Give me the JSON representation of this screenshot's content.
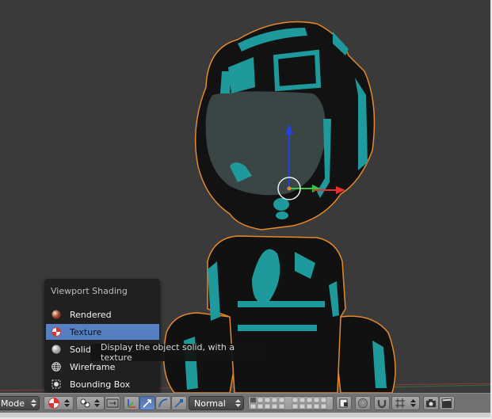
{
  "menu": {
    "title": "Viewport Shading",
    "items": [
      {
        "key": "rendered",
        "label": "Rendered",
        "icon": "rendered-sphere-icon",
        "active": false
      },
      {
        "key": "texture",
        "label": "Texture",
        "icon": "texture-checker-sphere-icon",
        "active": true
      },
      {
        "key": "solid",
        "label": "Solid",
        "icon": "solid-sphere-icon",
        "active": false
      },
      {
        "key": "wireframe",
        "label": "Wireframe",
        "icon": "wireframe-sphere-icon",
        "active": false
      },
      {
        "key": "bounding_box",
        "label": "Bounding Box",
        "icon": "bounding-box-icon",
        "active": false
      }
    ]
  },
  "tooltip": {
    "text": "Display the object solid, with a texture"
  },
  "toolbar": {
    "mode_label": "Mode",
    "pivot_label": "Normal"
  },
  "colors": {
    "accent": "#5680c2",
    "mesh_accent": "#1f9a9c",
    "outline": "#e58a2c",
    "axis_x": "#e83030",
    "axis_y": "#2ecc40",
    "axis_z": "#2244dd"
  }
}
